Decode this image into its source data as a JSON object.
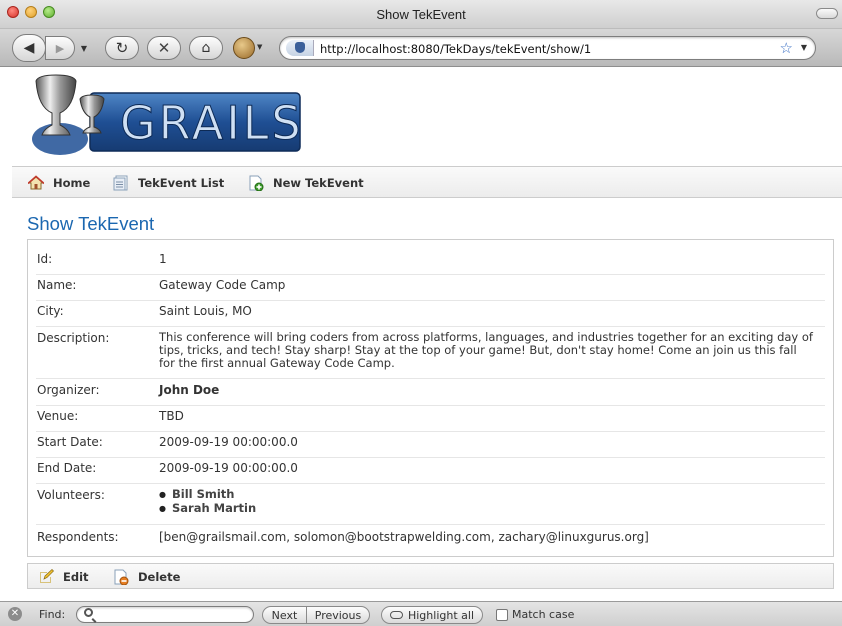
{
  "window": {
    "title": "Show TekEvent"
  },
  "browser": {
    "url": "http://localhost:8080/TekDays/tekEvent/show/1",
    "icons": [
      "back-icon",
      "forward-icon",
      "reload-icon",
      "stop-icon",
      "home-icon",
      "bookmark-star-icon"
    ]
  },
  "app": {
    "logo_text": "GRAILS",
    "nav": [
      {
        "label": "Home",
        "icon": "home-icon"
      },
      {
        "label": "TekEvent List",
        "icon": "list-icon"
      },
      {
        "label": "New TekEvent",
        "icon": "new-document-icon"
      }
    ],
    "page_title": "Show TekEvent",
    "fields": {
      "id": {
        "label": "Id:",
        "value": "1"
      },
      "name": {
        "label": "Name:",
        "value": "Gateway Code Camp"
      },
      "city": {
        "label": "City:",
        "value": "Saint Louis, MO"
      },
      "description": {
        "label": "Description:",
        "value": "This conference will bring coders from across platforms, languages, and industries together for an exciting day of tips, tricks, and tech! Stay sharp! Stay at the top of your game! But, don't stay home! Come an join us this fall for the first annual Gateway Code Camp."
      },
      "organizer": {
        "label": "Organizer:",
        "value": "John Doe"
      },
      "venue": {
        "label": "Venue:",
        "value": "TBD"
      },
      "start_date": {
        "label": "Start Date:",
        "value": "2009-09-19 00:00:00.0"
      },
      "end_date": {
        "label": "End Date:",
        "value": "2009-09-19 00:00:00.0"
      },
      "volunteers": {
        "label": "Volunteers:",
        "items": [
          "Bill Smith",
          "Sarah Martin"
        ]
      },
      "respondents": {
        "label": "Respondents:",
        "value": "[ben@grailsmail.com, solomon@bootstrapwelding.com, zachary@linuxgurus.org]"
      }
    },
    "buttons": {
      "edit": "Edit",
      "delete": "Delete"
    }
  },
  "findbar": {
    "label": "Find:",
    "value": "",
    "next": "Next",
    "previous": "Previous",
    "highlight_all": "Highlight all",
    "match_case": "Match case",
    "match_case_checked": false
  }
}
